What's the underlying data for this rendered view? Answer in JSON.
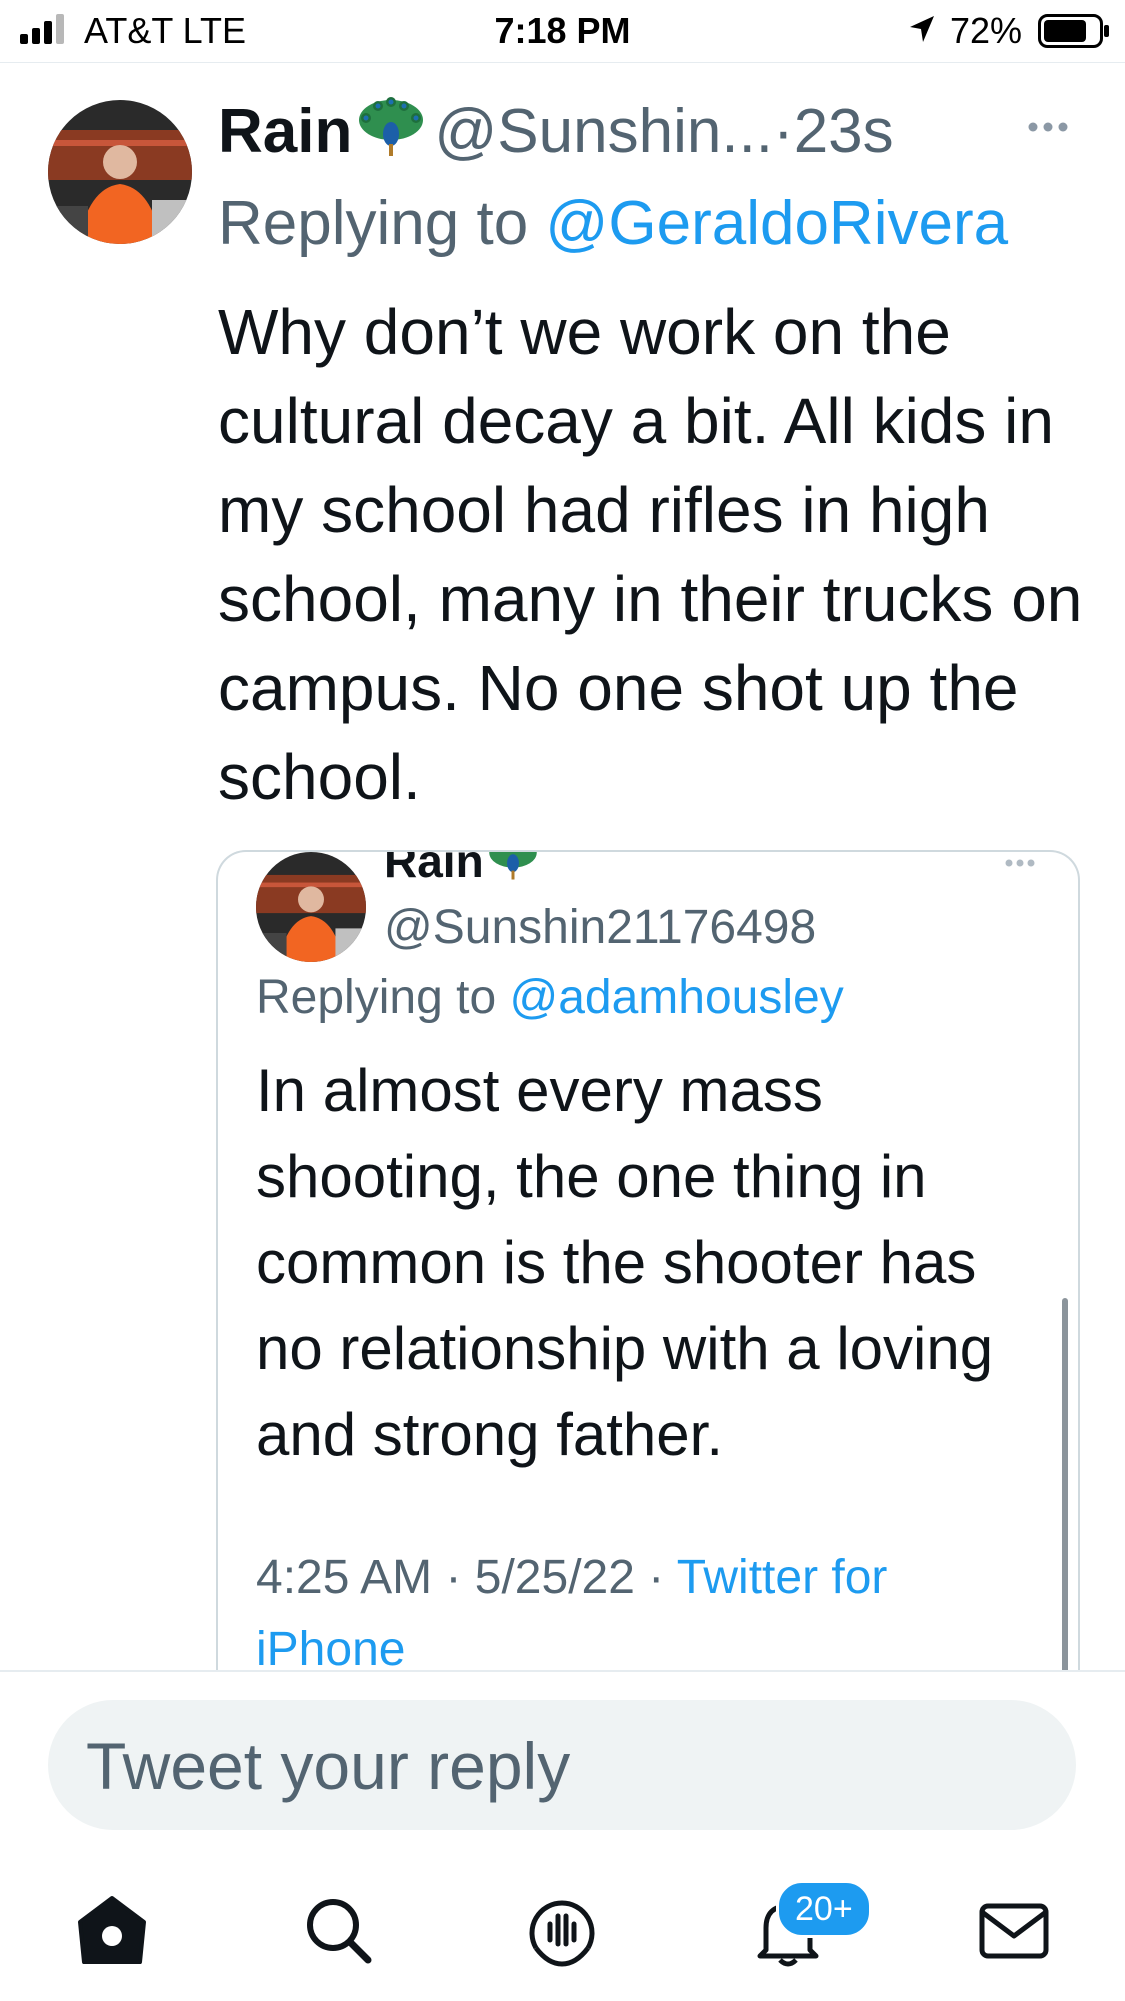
{
  "status_bar": {
    "carrier": "AT&T  LTE",
    "time": "7:18 PM",
    "battery": "72%",
    "icons": [
      "signal-icon",
      "location-arrow-icon",
      "battery-icon"
    ]
  },
  "tweet": {
    "display_name": "Rain",
    "name_emoji": "peacock-icon",
    "handle": "@Sunshin...",
    "separator": "·",
    "age": "23s",
    "replying_prefix": "Replying to ",
    "replying_handle": "@GeraldoRivera",
    "text": "Why don’t we work on the cultural decay a bit. All kids in my school had rifles in high school, many in their trucks on campus. No one shot up the school."
  },
  "quoted_tweet": {
    "display_name": "Rain",
    "handle": "@Sunshin21176498",
    "replying_prefix": "Replying to ",
    "replying_handle": "@adamhousley",
    "text": "In almost every mass shooting, the one thing in common is the shooter has no relationship with a loving and strong father.",
    "time": "4:25 AM · 5/25/22 · ",
    "source": "Twitter for iPhone"
  },
  "reply_box": {
    "placeholder": "Tweet your reply"
  },
  "tab_bar": {
    "tabs": [
      "home-icon",
      "search-icon",
      "spaces-icon",
      "notifications-icon",
      "messages-icon"
    ],
    "notifications_badge": "20+"
  },
  "colors": {
    "link": "#1d9bf0",
    "secondary_text": "#536471",
    "primary_text": "#0f1419",
    "border": "#cfd9de",
    "badge": "#1d9bf0"
  }
}
